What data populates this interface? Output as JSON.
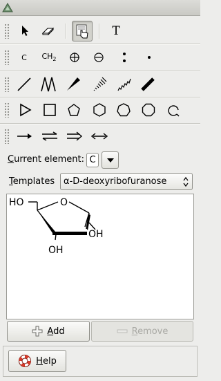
{
  "toolbar": {
    "row1": [
      {
        "name": "select-arrow-icon"
      },
      {
        "name": "eraser-icon"
      },
      {
        "name": "template-hand-icon",
        "active": true
      },
      {
        "name": "text-tool-icon",
        "label": "T"
      }
    ],
    "row2_labels": {
      "carbon": "C",
      "ch2_main": "CH",
      "ch2_sub": "2"
    },
    "row2_icons": [
      "charge-plus-icon",
      "charge-minus-icon",
      "lone-pair-icon",
      "radical-icon"
    ],
    "row3": [
      "single-bond-icon",
      "chain-icon",
      "wedge-bond-icon",
      "hash-bond-icon",
      "wavy-bond-icon",
      "bold-bond-icon"
    ],
    "row4": [
      "triangle-ring-icon",
      "square-ring-icon",
      "pentagon-ring-icon",
      "hexagon-ring-icon",
      "heptagon-ring-icon",
      "octagon-ring-icon",
      "cycle-chain-icon"
    ],
    "row5": [
      "reaction-arrow-icon",
      "equilibrium-arrow-icon",
      "double-arrow-icon",
      "resonance-arrow-icon"
    ]
  },
  "current_element": {
    "label_underlined": "C",
    "label_rest": "urrent element:",
    "value": "C"
  },
  "templates": {
    "label_underlined": "T",
    "label_rest": "emplates",
    "selected": "α-D-deoxyribofuranose"
  },
  "molecule": {
    "labels": [
      "HO",
      "O",
      "OH",
      "OH"
    ]
  },
  "buttons": {
    "add_underlined": "A",
    "add_rest": "dd",
    "remove_underlined": "R",
    "remove_rest": "emove",
    "help_underlined": "H",
    "help_rest": "elp"
  },
  "colors": {
    "window_bg": "#ededeb",
    "pen_red": "#c0392b"
  }
}
